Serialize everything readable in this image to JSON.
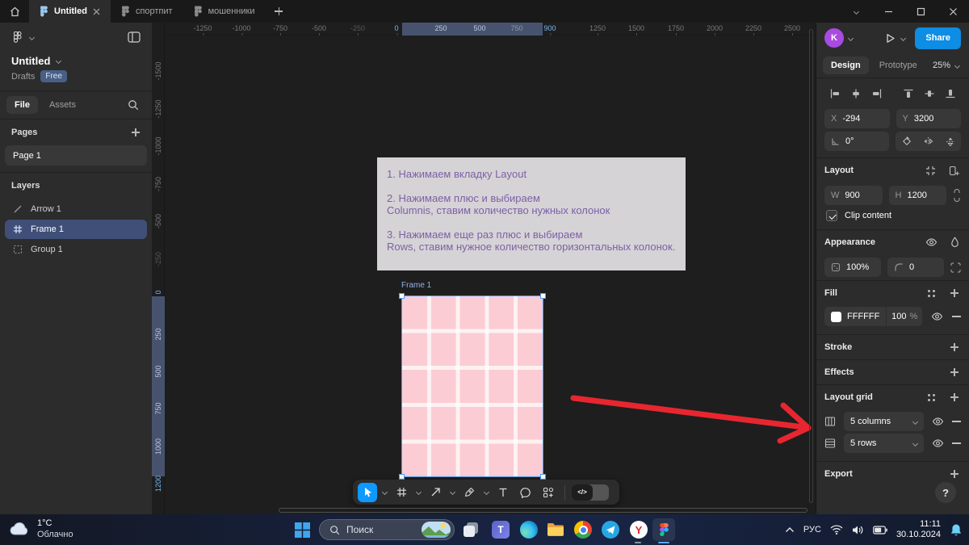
{
  "colors": {
    "accent_blue": "#0d99ff",
    "selection_blue": "#4f9cf0",
    "frame_fill": "#fbccd3",
    "arrow_red": "#e8262f",
    "note_bg": "#d5d3d6",
    "note_text": "#7e61a6",
    "panel_bg": "#2c2c2c",
    "canvas_bg": "#1e1e1e"
  },
  "tabbar": {
    "tabs": [
      {
        "label": "Untitled",
        "active": true
      },
      {
        "label": "спортпит",
        "active": false
      },
      {
        "label": "мошенники",
        "active": false
      }
    ]
  },
  "sidebar": {
    "file_name": "Untitled",
    "breadcrumb": "Drafts",
    "plan_badge": "Free",
    "nav_tabs": {
      "file": "File",
      "assets": "Assets"
    },
    "pages_header": "Pages",
    "pages": [
      {
        "name": "Page 1"
      }
    ],
    "layers_header": "Layers",
    "layers": [
      {
        "name": "Arrow 1"
      },
      {
        "name": "Frame 1"
      },
      {
        "name": "Group 1"
      }
    ]
  },
  "inspector": {
    "avatar_initial": "K",
    "share_label": "Share",
    "tabs": {
      "design": "Design",
      "prototype": "Prototype"
    },
    "zoom_level": "25%",
    "position": {
      "x_label": "X",
      "x_value": "-294",
      "y_label": "Y",
      "y_value": "3200",
      "rotation": "0°"
    },
    "layout": {
      "title": "Layout",
      "w_label": "W",
      "w_value": "900",
      "h_label": "H",
      "h_value": "1200",
      "clip_label": "Clip content"
    },
    "appearance": {
      "title": "Appearance",
      "opacity": "100%",
      "corner_radius": "0"
    },
    "fill": {
      "title": "Fill",
      "hex": "FFFFFF",
      "opacity": "100",
      "unit": "%"
    },
    "stroke_title": "Stroke",
    "effects_title": "Effects",
    "layout_grid": {
      "title": "Layout grid",
      "grids": [
        {
          "value": "5 columns"
        },
        {
          "value": "5 rows"
        }
      ]
    },
    "export_title": "Export",
    "help_label": "?"
  },
  "canvas": {
    "note": {
      "line1": "1. Нажимаем вкладку  Layout",
      "line2a": "2. Нажимаем плюс и выбираем",
      "line2b": "Columnis, ставим количество нужных колонок",
      "line3a": "3. Нажимаем еще раз плюс и выбираем",
      "line3b": "Rows, ставим нужное количество горизонтальных колонок."
    },
    "frame_label": "Frame 1",
    "rulers": {
      "top": [
        "-1250",
        "-1000",
        "-750",
        "-500",
        "-250",
        "0",
        "250",
        "500",
        "750",
        "900",
        "1250",
        "1500",
        "1750",
        "2000",
        "2250",
        "2500"
      ],
      "left": [
        "-1500",
        "-1250",
        "-1000",
        "-750",
        "-500",
        "-250",
        "0",
        "250",
        "500",
        "750",
        "1000",
        "1200"
      ]
    }
  },
  "toolbar": {
    "dev_toggle_label": "</>"
  },
  "taskbar": {
    "weather_temp": "1°C",
    "weather_condition": "Облачно",
    "search_placeholder": "Поиск",
    "language": "РУС",
    "time": "11:11",
    "date": "30.10.2024"
  }
}
